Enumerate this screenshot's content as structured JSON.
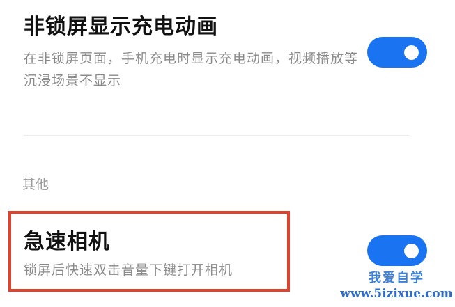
{
  "settings": [
    {
      "title": "非锁屏显示充电动画",
      "description": "在非锁屏页面，手机充电时显示充电动画，视频播放等沉浸场景不显示",
      "enabled": true
    },
    {
      "title": "急速相机",
      "description": "锁屏后快速双击音量下键打开相机",
      "enabled": true
    }
  ],
  "section_other": {
    "label": "其他"
  },
  "watermark": {
    "text": "我爱自学",
    "url": "www.5izixue.com"
  },
  "colors": {
    "toggle_on": "#1a73f0",
    "highlight_border": "#e0432b",
    "title_text": "#111111",
    "description_text": "#8a8a8a"
  }
}
